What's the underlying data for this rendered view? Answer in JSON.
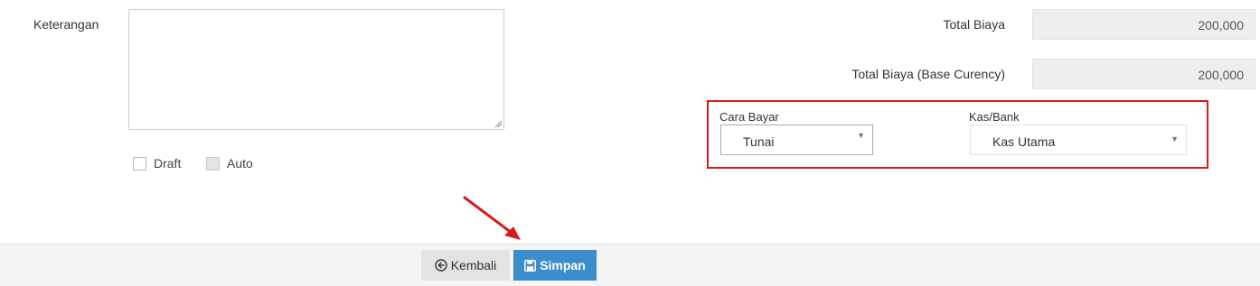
{
  "form": {
    "keterangan_label": "Keterangan",
    "keterangan_value": "",
    "draft_label": "Draft",
    "auto_label": "Auto",
    "total_biaya_label": "Total Biaya",
    "total_biaya_value": "200,000",
    "total_biaya_base_label": "Total Biaya (Base Curency)",
    "total_biaya_base_value": "200,000"
  },
  "payment": {
    "cara_bayar_label": "Cara Bayar",
    "cara_bayar_value": "Tunai",
    "kas_bank_label": "Kas/Bank",
    "kas_bank_value": "Kas Utama"
  },
  "footer": {
    "back_label": "Kembali",
    "save_label": "Simpan"
  },
  "colors": {
    "highlight": "#d71a1a",
    "save_button": "#3c8dcb",
    "annotation_arrow": "#d71a1a"
  },
  "icons": {
    "back": "arrow-circle-left-icon",
    "save": "floppy-disk-icon",
    "dropdown": "caret-down-icon"
  }
}
